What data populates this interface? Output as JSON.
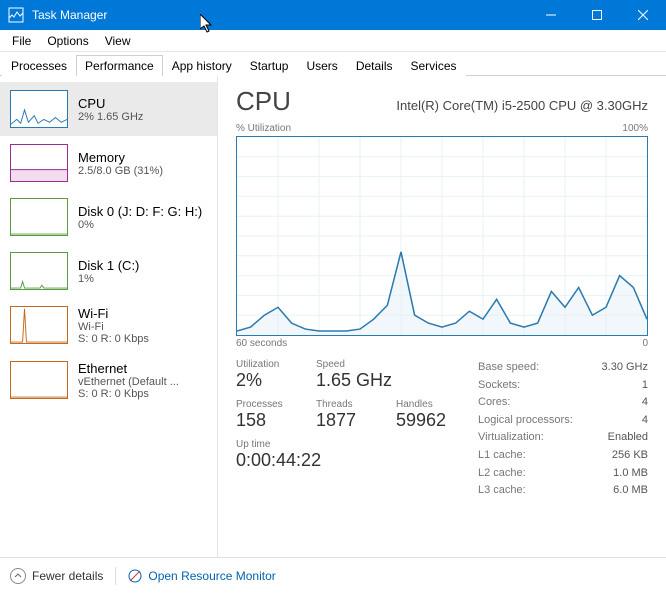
{
  "window": {
    "title": "Task Manager"
  },
  "menu": {
    "file": "File",
    "options": "Options",
    "view": "View"
  },
  "tabs": {
    "processes": "Processes",
    "performance": "Performance",
    "app_history": "App history",
    "startup": "Startup",
    "users": "Users",
    "details": "Details",
    "services": "Services"
  },
  "sidebar": {
    "items": [
      {
        "label": "CPU",
        "sub": "2% 1.65 GHz"
      },
      {
        "label": "Memory",
        "sub": "2.5/8.0 GB (31%)"
      },
      {
        "label": "Disk 0 (J: D: F: G: H:)",
        "sub": "0%"
      },
      {
        "label": "Disk 1 (C:)",
        "sub": "1%"
      },
      {
        "label": "Wi-Fi",
        "sub": "Wi-Fi",
        "sub2": "S: 0 R: 0 Kbps"
      },
      {
        "label": "Ethernet",
        "sub": "vEthernet (Default ...",
        "sub2": "S: 0 R: 0 Kbps"
      }
    ]
  },
  "main": {
    "title": "CPU",
    "subtitle": "Intel(R) Core(TM) i5-2500 CPU @ 3.30GHz",
    "util_label": "% Utilization",
    "util_max": "100%",
    "x_left": "60 seconds",
    "x_right": "0",
    "stats": {
      "utilization": {
        "label": "Utilization",
        "value": "2%"
      },
      "speed": {
        "label": "Speed",
        "value": "1.65 GHz"
      },
      "processes": {
        "label": "Processes",
        "value": "158"
      },
      "threads": {
        "label": "Threads",
        "value": "1877"
      },
      "handles": {
        "label": "Handles",
        "value": "59962"
      },
      "uptime": {
        "label": "Up time",
        "value": "0:00:44:22"
      }
    },
    "details": {
      "base_speed": {
        "k": "Base speed:",
        "v": "3.30 GHz"
      },
      "sockets": {
        "k": "Sockets:",
        "v": "1"
      },
      "cores": {
        "k": "Cores:",
        "v": "4"
      },
      "logical": {
        "k": "Logical processors:",
        "v": "4"
      },
      "virtualization": {
        "k": "Virtualization:",
        "v": "Enabled"
      },
      "l1": {
        "k": "L1 cache:",
        "v": "256 KB"
      },
      "l2": {
        "k": "L2 cache:",
        "v": "1.0 MB"
      },
      "l3": {
        "k": "L3 cache:",
        "v": "6.0 MB"
      }
    }
  },
  "footer": {
    "fewer": "Fewer details",
    "orm": "Open Resource Monitor"
  },
  "chart_data": {
    "type": "line",
    "title": "CPU % Utilization",
    "xlabel": "seconds ago",
    "ylabel": "% Utilization",
    "ylim": [
      0,
      100
    ],
    "xlim": [
      60,
      0
    ],
    "x": [
      60,
      58,
      56,
      54,
      52,
      50,
      48,
      46,
      44,
      42,
      40,
      38,
      36,
      34,
      32,
      30,
      28,
      26,
      24,
      22,
      20,
      18,
      16,
      14,
      12,
      10,
      8,
      6,
      4,
      2,
      0
    ],
    "values": [
      2,
      4,
      10,
      14,
      6,
      3,
      2,
      2,
      2,
      3,
      8,
      15,
      42,
      10,
      6,
      4,
      6,
      12,
      8,
      18,
      6,
      4,
      6,
      22,
      14,
      24,
      10,
      14,
      30,
      24,
      8
    ]
  }
}
